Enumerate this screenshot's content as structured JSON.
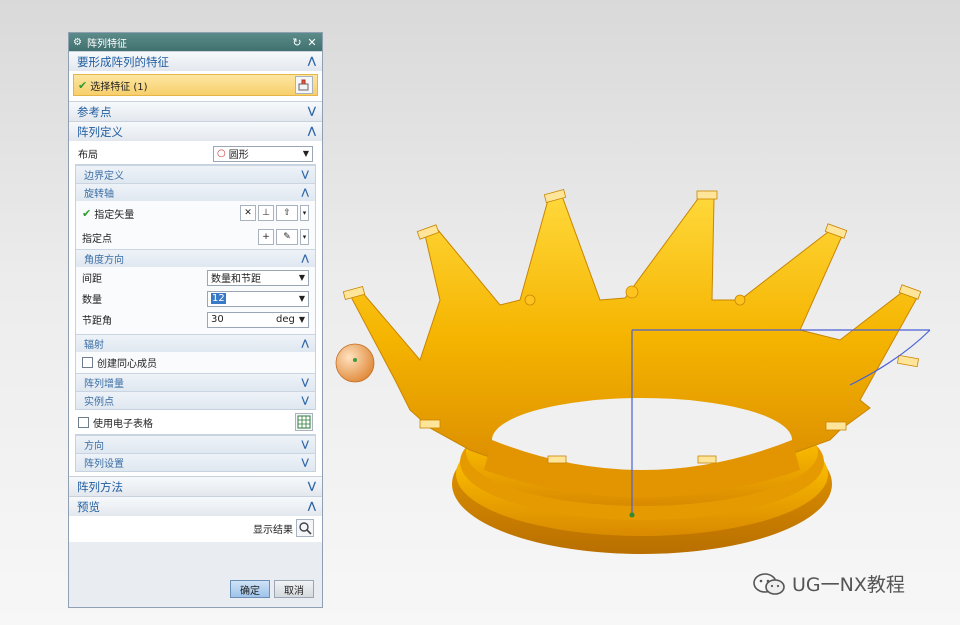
{
  "dialog": {
    "title": "阵列特征",
    "sections": {
      "features": {
        "title": "要形成阵列的特征",
        "select_label": "选择特征 (1)"
      },
      "reference": {
        "title": "参考点"
      },
      "definition": {
        "title": "阵列定义",
        "layout_label": "布局",
        "layout_value": "圆形",
        "boundary": "边界定义",
        "rotation_axis": "旋转轴",
        "specify_vector": "指定矢量",
        "specify_point": "指定点",
        "angle_direction": "角度方向",
        "spacing_label": "间距",
        "spacing_value": "数量和节距",
        "count_label": "数量",
        "count_value": "12",
        "pitch_label": "节距角",
        "pitch_value": "30",
        "pitch_unit": "deg",
        "radial": "辐射",
        "concentric_label": "创建同心成员",
        "increment": "阵列增量",
        "instance_point": "实例点",
        "spreadsheet_label": "使用电子表格",
        "orientation": "方向",
        "settings": "阵列设置"
      },
      "method": {
        "title": "阵列方法"
      },
      "preview": {
        "title": "预览",
        "show_result": "显示结果"
      }
    },
    "buttons": {
      "ok": "确定",
      "cancel": "取消"
    }
  },
  "watermark": "UG一NX教程",
  "colors": {
    "crown": "#f5b400",
    "accent_title": "#4a7c7a",
    "section_text": "#1f5da0"
  },
  "icons": {
    "title": "gear-icon",
    "reset": "reset-icon",
    "close": "close-icon",
    "feature_select": "select-feature-icon",
    "search": "magnifier-icon"
  }
}
